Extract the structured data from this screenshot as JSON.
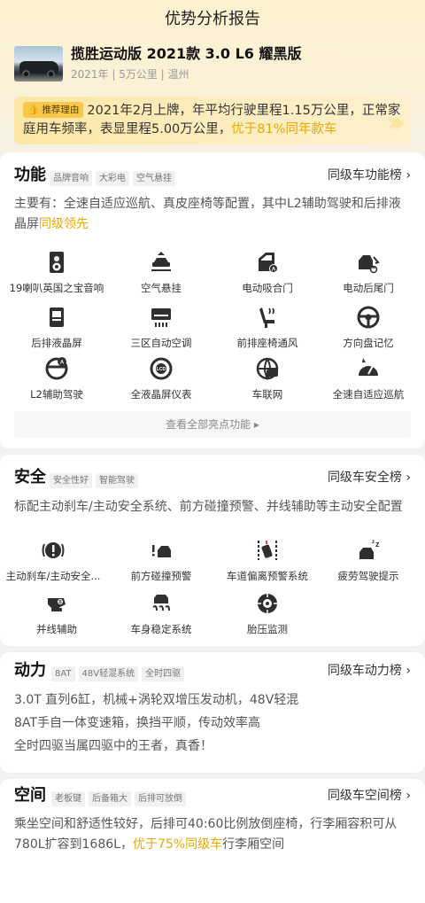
{
  "header": {
    "title": "优势分析报告"
  },
  "car": {
    "title": "揽胜运动版 2021款 3.0 L6 耀黑版",
    "meta": "2021年 | 5万公里 | 温州"
  },
  "recommend": {
    "tag": "推荐理由",
    "text": "2021年2月上牌，年平均行驶里程1.15万公里，正常家庭用车频率，表显里程5.00万公里，",
    "highlight": "优于81%同年款车"
  },
  "features": {
    "title": "功能",
    "chips": [
      "品牌音响",
      "大彩电",
      "空气悬挂"
    ],
    "link": "同级车功能榜",
    "desc": "主要有：全速自适应巡航、真皮座椅等配置，其中L2辅助驾驶和后排液晶屏",
    "desc_highlight": "同级领先",
    "items": [
      {
        "label": "19喇叭英国之宝音响",
        "icon": "speaker-icon"
      },
      {
        "label": "空气悬挂",
        "icon": "air-suspension-icon"
      },
      {
        "label": "电动吸合门",
        "icon": "soft-close-door-icon"
      },
      {
        "label": "电动后尾门",
        "icon": "power-tailgate-icon"
      },
      {
        "label": "后排液晶屏",
        "icon": "rear-screen-icon"
      },
      {
        "label": "三区自动空调",
        "icon": "air-conditioner-icon"
      },
      {
        "label": "前排座椅通风",
        "icon": "seat-ventilation-icon"
      },
      {
        "label": "方向盘记忆",
        "icon": "steering-wheel-icon"
      },
      {
        "label": "L2辅助驾驶",
        "icon": "driver-assist-icon"
      },
      {
        "label": "全液晶屏仪表",
        "icon": "lcd-dashboard-icon"
      },
      {
        "label": "车联网",
        "icon": "connected-car-icon"
      },
      {
        "label": "全速自适应巡航",
        "icon": "adaptive-cruise-icon"
      }
    ],
    "view_all": "查看全部亮点功能"
  },
  "safety": {
    "title": "安全",
    "chips": [
      "安全性好",
      "智能驾驶"
    ],
    "link": "同级车安全榜",
    "desc": "标配主动刹车/主动安全系统、前方碰撞预警、并线辅助等主动安全配置",
    "items": [
      {
        "label": "主动刹车/主动安全...",
        "icon": "active-brake-icon"
      },
      {
        "label": "前方碰撞预警",
        "icon": "collision-warning-icon"
      },
      {
        "label": "车道偏离预警系统",
        "icon": "lane-departure-icon"
      },
      {
        "label": "疲劳驾驶提示",
        "icon": "fatigue-alert-icon"
      },
      {
        "label": "并线辅助",
        "icon": "blind-spot-icon"
      },
      {
        "label": "车身稳定系统",
        "icon": "stability-control-icon"
      },
      {
        "label": "胎压监测",
        "icon": "tire-pressure-icon"
      }
    ]
  },
  "power": {
    "title": "动力",
    "chips": [
      "8AT",
      "48V轻混系统",
      "全时四驱"
    ],
    "link": "同级车动力榜",
    "lines": [
      "3.0T 直列6缸，机械+涡轮双增压发动机，48V轻混",
      "8AT手自一体变速箱，换挡平顺，传动效率高",
      "全时四驱当属四驱中的王者，真香！"
    ]
  },
  "space": {
    "title": "空间",
    "chips": [
      "老板键",
      "后备箱大",
      "后排可放倒"
    ],
    "link": "同级车空间榜",
    "desc": "乘坐空间和舒适性较好，后排可40:60比例放倒座椅，行李厢容积可从780L扩容到1686L，",
    "desc_highlight": "优于75%同级车",
    "desc_tail": "行李厢空间"
  }
}
